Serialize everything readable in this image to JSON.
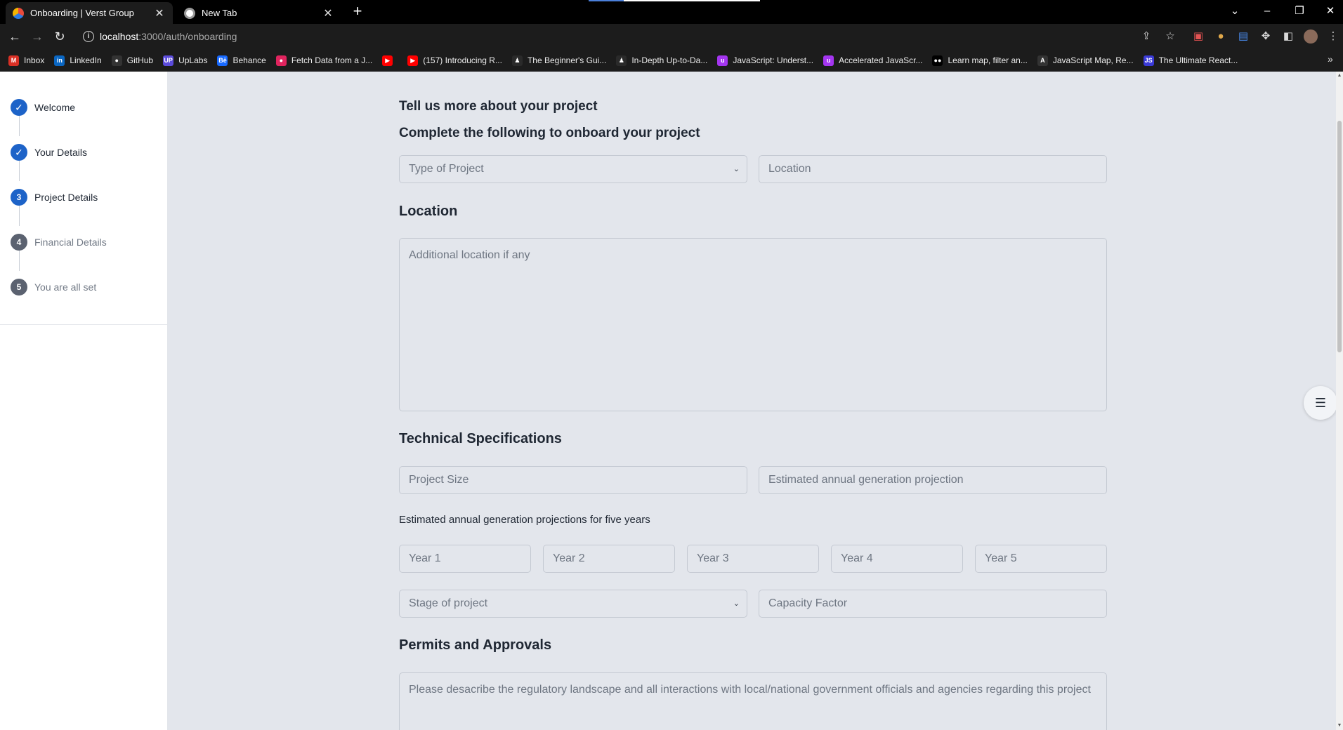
{
  "browser": {
    "tabs": [
      {
        "title": "Onboarding | Verst Group",
        "active": true,
        "icon": "verst-logo-icon"
      },
      {
        "title": "New Tab",
        "active": false,
        "icon": "chrome-icon"
      }
    ],
    "new_tab": "+",
    "window_controls": {
      "dropdown": "⌄",
      "minimize": "–",
      "restore": "❐",
      "close": "✕"
    },
    "url": {
      "host": "localhost",
      "path": ":3000/auth/onboarding"
    },
    "bookmarks": [
      {
        "label": "Inbox",
        "icon": "gmail-icon",
        "color": "#d93025",
        "glyph": "M"
      },
      {
        "label": "LinkedIn",
        "icon": "linkedin-icon",
        "color": "#0a66c2",
        "glyph": "in"
      },
      {
        "label": "GitHub",
        "icon": "github-icon",
        "color": "#333333",
        "glyph": "●"
      },
      {
        "label": "UpLabs",
        "icon": "uplabs-icon",
        "color": "#5b4bdb",
        "glyph": "UP"
      },
      {
        "label": "Behance",
        "icon": "behance-icon",
        "color": "#1769ff",
        "glyph": "Bē"
      },
      {
        "label": "Fetch Data from a J...",
        "icon": "pink-logo-icon",
        "color": "#e0245e",
        "glyph": "●"
      },
      {
        "label": "",
        "icon": "youtube-icon",
        "color": "#ff0000",
        "glyph": "▶"
      },
      {
        "label": "(157) Introducing R...",
        "icon": "youtube-icon",
        "color": "#ff0000",
        "glyph": "▶"
      },
      {
        "label": "The Beginner's Gui...",
        "icon": "person-icon",
        "color": "#2a2a2a",
        "glyph": "♟"
      },
      {
        "label": "In-Depth Up-to-Da...",
        "icon": "person-icon",
        "color": "#2a2a2a",
        "glyph": "♟"
      },
      {
        "label": "JavaScript: Underst...",
        "icon": "udemy-icon",
        "color": "#a435f0",
        "glyph": "u"
      },
      {
        "label": "Accelerated JavaScr...",
        "icon": "udemy-icon",
        "color": "#a435f0",
        "glyph": "u"
      },
      {
        "label": "Learn map, filter an...",
        "icon": "medium-icon",
        "color": "#000000",
        "glyph": "●●"
      },
      {
        "label": "JavaScript Map, Re...",
        "icon": "at-logo-icon",
        "color": "#333333",
        "glyph": "A"
      },
      {
        "label": "The Ultimate React...",
        "icon": "js-icon",
        "color": "#3a3ad6",
        "glyph": "JS"
      }
    ],
    "bookmarks_more": "»"
  },
  "steps": [
    {
      "num": "✓",
      "label": "Welcome",
      "state": "done"
    },
    {
      "num": "✓",
      "label": "Your Details",
      "state": "done"
    },
    {
      "num": "3",
      "label": "Project Details",
      "state": "current"
    },
    {
      "num": "4",
      "label": "Financial Details",
      "state": "todo"
    },
    {
      "num": "5",
      "label": "You are all set",
      "state": "todo"
    }
  ],
  "form": {
    "title": "Tell us more about your project",
    "subtitle": "Complete the following to onboard your project",
    "project_type_placeholder": "Type of Project",
    "location_placeholder": "Location",
    "location_heading": "Location",
    "additional_location_placeholder": "Additional location if any",
    "tech_heading": "Technical Specifications",
    "project_size_placeholder": "Project Size",
    "annual_generation_placeholder": "Estimated annual generation projection",
    "five_year_label": "Estimated annual generation projections for five years",
    "years": [
      "Year 1",
      "Year 2",
      "Year 3",
      "Year 4",
      "Year 5"
    ],
    "stage_placeholder": "Stage of project",
    "capacity_placeholder": "Capacity Factor",
    "permits_heading": "Permits and Approvals",
    "permits_placeholder": "Please desacribe the regulatory landscape and all interactions with local/national government officials and agencies regarding this project"
  },
  "colors": {
    "accent": "#1d63c8",
    "page_bg": "#e3e6ec",
    "todo_step": "#5b6270"
  }
}
